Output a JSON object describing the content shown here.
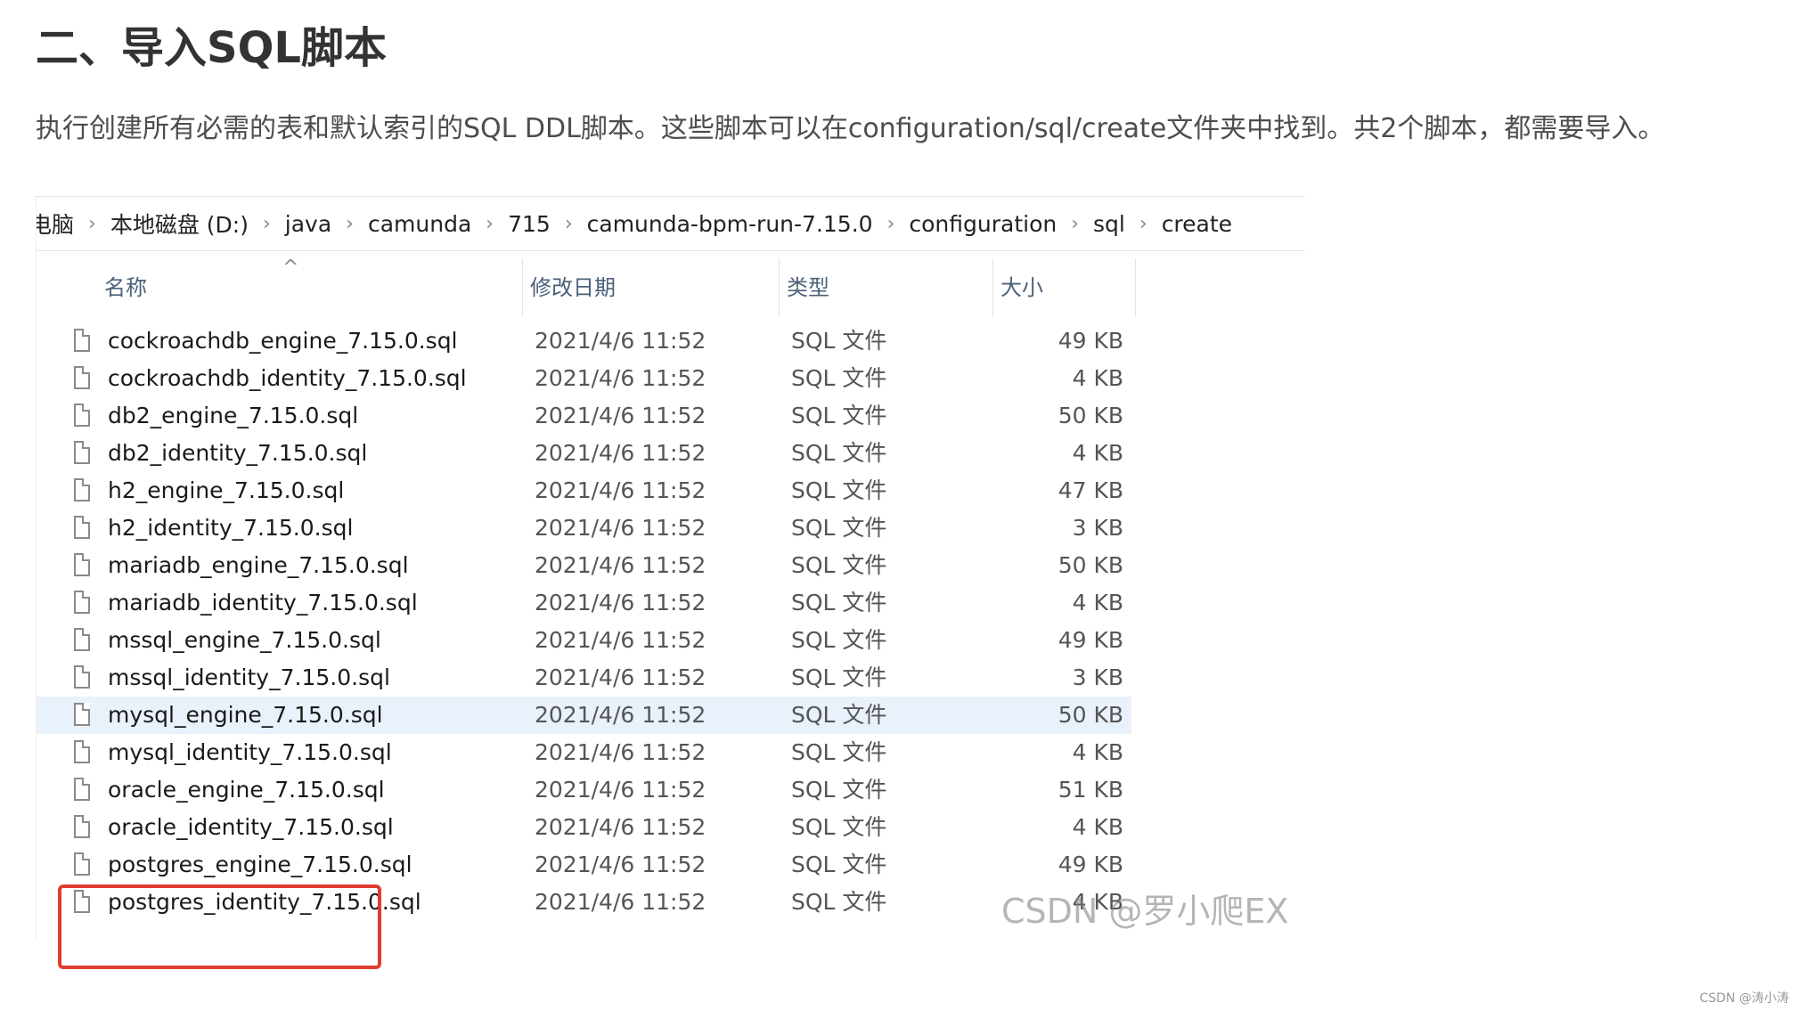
{
  "article": {
    "heading": "二、导入SQL脚本",
    "intro": "执行创建所有必需的表和默认索引的SQL DDL脚本。这些脚本可以在configuration/sql/create文件夹中找到。共2个脚本，都需要导入。"
  },
  "explorer": {
    "breadcrumb": [
      "电脑",
      "本地磁盘 (D:)",
      "java",
      "camunda",
      "715",
      "camunda-bpm-run-7.15.0",
      "configuration",
      "sql",
      "create"
    ],
    "breadcrumb_separator": "›",
    "columns": {
      "name": "名称",
      "date": "修改日期",
      "type": "类型",
      "size": "大小"
    },
    "sort_indicator": "^",
    "files": [
      {
        "name": "cockroachdb_engine_7.15.0.sql",
        "date": "2021/4/6 11:52",
        "type": "SQL 文件",
        "size": "49 KB"
      },
      {
        "name": "cockroachdb_identity_7.15.0.sql",
        "date": "2021/4/6 11:52",
        "type": "SQL 文件",
        "size": "4 KB"
      },
      {
        "name": "db2_engine_7.15.0.sql",
        "date": "2021/4/6 11:52",
        "type": "SQL 文件",
        "size": "50 KB"
      },
      {
        "name": "db2_identity_7.15.0.sql",
        "date": "2021/4/6 11:52",
        "type": "SQL 文件",
        "size": "4 KB"
      },
      {
        "name": "h2_engine_7.15.0.sql",
        "date": "2021/4/6 11:52",
        "type": "SQL 文件",
        "size": "47 KB"
      },
      {
        "name": "h2_identity_7.15.0.sql",
        "date": "2021/4/6 11:52",
        "type": "SQL 文件",
        "size": "3 KB"
      },
      {
        "name": "mariadb_engine_7.15.0.sql",
        "date": "2021/4/6 11:52",
        "type": "SQL 文件",
        "size": "50 KB"
      },
      {
        "name": "mariadb_identity_7.15.0.sql",
        "date": "2021/4/6 11:52",
        "type": "SQL 文件",
        "size": "4 KB"
      },
      {
        "name": "mssql_engine_7.15.0.sql",
        "date": "2021/4/6 11:52",
        "type": "SQL 文件",
        "size": "49 KB"
      },
      {
        "name": "mssql_identity_7.15.0.sql",
        "date": "2021/4/6 11:52",
        "type": "SQL 文件",
        "size": "3 KB"
      },
      {
        "name": "mysql_engine_7.15.0.sql",
        "date": "2021/4/6 11:52",
        "type": "SQL 文件",
        "size": "50 KB",
        "highlighted": true
      },
      {
        "name": "mysql_identity_7.15.0.sql",
        "date": "2021/4/6 11:52",
        "type": "SQL 文件",
        "size": "4 KB"
      },
      {
        "name": "oracle_engine_7.15.0.sql",
        "date": "2021/4/6 11:52",
        "type": "SQL 文件",
        "size": "51 KB"
      },
      {
        "name": "oracle_identity_7.15.0.sql",
        "date": "2021/4/6 11:52",
        "type": "SQL 文件",
        "size": "4 KB"
      },
      {
        "name": "postgres_engine_7.15.0.sql",
        "date": "2021/4/6 11:52",
        "type": "SQL 文件",
        "size": "49 KB"
      },
      {
        "name": "postgres_identity_7.15.0.sql",
        "date": "2021/4/6 11:52",
        "type": "SQL 文件",
        "size": "4 KB"
      }
    ],
    "highlight_color": "#e03c31",
    "selected_row_color": "#e9f1fb"
  },
  "watermark": "CSDN @罗小爬EX",
  "credit": "CSDN @涛小涛"
}
